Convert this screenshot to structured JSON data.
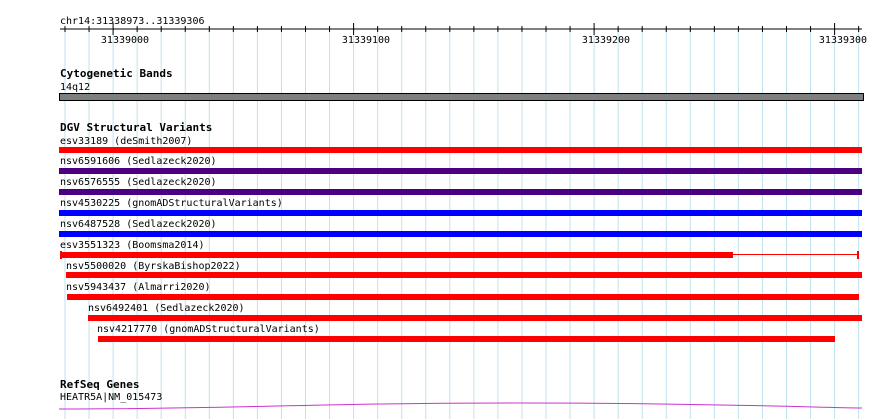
{
  "ruler": {
    "locus": "chr14:31338973..31339306",
    "tick_labels": [
      "31339000",
      "31339100",
      "31339200",
      "31339300"
    ]
  },
  "cytoband_track": {
    "title": "Cytogenetic Bands",
    "band_label": "14q12",
    "band_color": "#7f7f7f"
  },
  "dgv_track": {
    "title": "DGV Structural Variants",
    "features": [
      {
        "label": "esv33189 (deSmith2007)",
        "color": "#ff0000"
      },
      {
        "label": "nsv6591606 (Sedlazeck2020)",
        "color": "#4b0082"
      },
      {
        "label": "nsv6576555 (Sedlazeck2020)",
        "color": "#4b0082"
      },
      {
        "label": "nsv4530225 (gnomADStructuralVariants)",
        "color": "#0000ff"
      },
      {
        "label": "nsv6487528 (Sedlazeck2020)",
        "color": "#0000ff"
      },
      {
        "label": "esv3551323 (Boomsma2014)",
        "color": "#ff0000"
      },
      {
        "label": "nsv5500020 (ByrskaBishop2022)",
        "color": "#ff0000"
      },
      {
        "label": "nsv5943437 (Almarri2020)",
        "color": "#ff0000"
      },
      {
        "label": "nsv6492401 (Sedlazeck2020)",
        "color": "#ff0000"
      },
      {
        "label": "nsv4217770 (gnomADStructuralVariants)",
        "color": "#ff0000"
      }
    ]
  },
  "refseq_track": {
    "title": "RefSeq Genes",
    "gene_label": "HEATR5A|NM_015473",
    "gene_color": "#cc33cc"
  },
  "colors": {
    "gridline": "#bfe3ee",
    "ruler": "#000000"
  }
}
